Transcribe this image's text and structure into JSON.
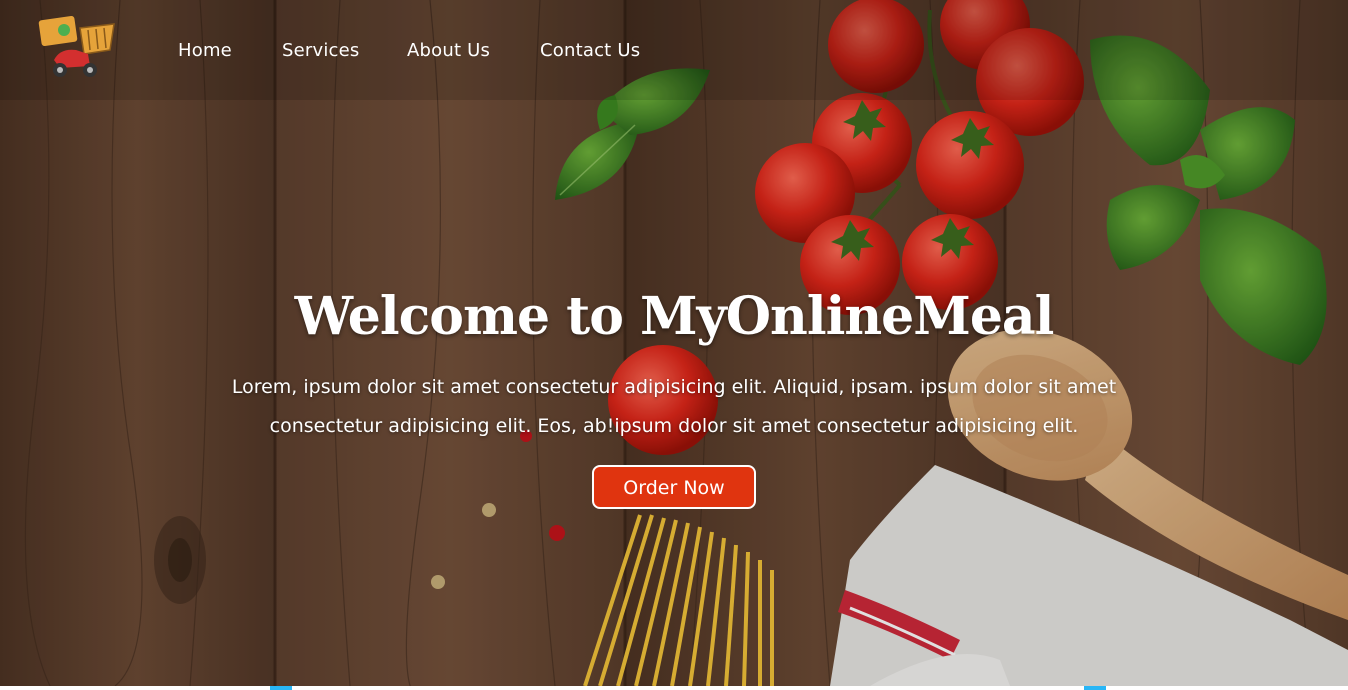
{
  "nav": {
    "logo_icon": "delivery-scooter-logo-icon",
    "links": [
      "Home",
      "Services",
      "About Us",
      "Contact Us"
    ]
  },
  "hero": {
    "title": "Welcome to MyOnlineMeal",
    "description": "Lorem, ipsum dolor sit amet consectetur adipisicing elit. Aliquid, ipsam. ipsum dolor sit amet consectetur adipisicing elit. Eos, ab!ipsum dolor sit amet consectetur adipisicing elit.",
    "button_label": "Order Now",
    "background_image": "wooden-table-with-tomatoes-basil-pasta-spoon-towel"
  },
  "colors": {
    "accent": "#e0340f",
    "wood": "#5a3d2b",
    "text": "#ffffff",
    "bottom_accent": "#29b6f6"
  }
}
